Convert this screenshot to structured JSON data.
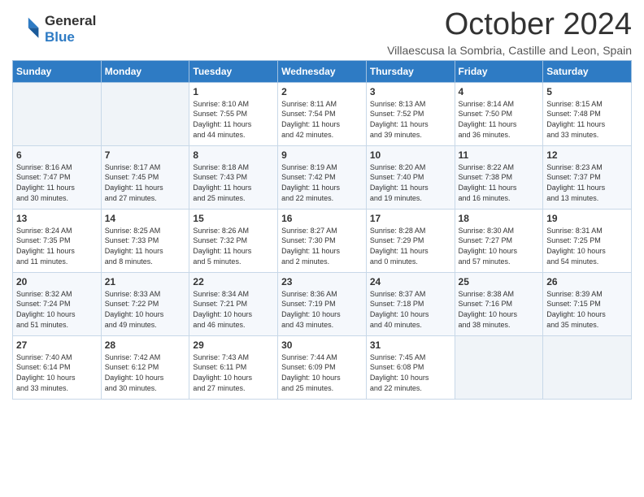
{
  "logo": {
    "line1": "General",
    "line2": "Blue"
  },
  "title": "October 2024",
  "subtitle": "Villaescusa la Sombria, Castille and Leon, Spain",
  "days_of_week": [
    "Sunday",
    "Monday",
    "Tuesday",
    "Wednesday",
    "Thursday",
    "Friday",
    "Saturday"
  ],
  "weeks": [
    [
      {
        "day": "",
        "lines": []
      },
      {
        "day": "",
        "lines": []
      },
      {
        "day": "1",
        "lines": [
          "Sunrise: 8:10 AM",
          "Sunset: 7:55 PM",
          "Daylight: 11 hours",
          "and 44 minutes."
        ]
      },
      {
        "day": "2",
        "lines": [
          "Sunrise: 8:11 AM",
          "Sunset: 7:54 PM",
          "Daylight: 11 hours",
          "and 42 minutes."
        ]
      },
      {
        "day": "3",
        "lines": [
          "Sunrise: 8:13 AM",
          "Sunset: 7:52 PM",
          "Daylight: 11 hours",
          "and 39 minutes."
        ]
      },
      {
        "day": "4",
        "lines": [
          "Sunrise: 8:14 AM",
          "Sunset: 7:50 PM",
          "Daylight: 11 hours",
          "and 36 minutes."
        ]
      },
      {
        "day": "5",
        "lines": [
          "Sunrise: 8:15 AM",
          "Sunset: 7:48 PM",
          "Daylight: 11 hours",
          "and 33 minutes."
        ]
      }
    ],
    [
      {
        "day": "6",
        "lines": [
          "Sunrise: 8:16 AM",
          "Sunset: 7:47 PM",
          "Daylight: 11 hours",
          "and 30 minutes."
        ]
      },
      {
        "day": "7",
        "lines": [
          "Sunrise: 8:17 AM",
          "Sunset: 7:45 PM",
          "Daylight: 11 hours",
          "and 27 minutes."
        ]
      },
      {
        "day": "8",
        "lines": [
          "Sunrise: 8:18 AM",
          "Sunset: 7:43 PM",
          "Daylight: 11 hours",
          "and 25 minutes."
        ]
      },
      {
        "day": "9",
        "lines": [
          "Sunrise: 8:19 AM",
          "Sunset: 7:42 PM",
          "Daylight: 11 hours",
          "and 22 minutes."
        ]
      },
      {
        "day": "10",
        "lines": [
          "Sunrise: 8:20 AM",
          "Sunset: 7:40 PM",
          "Daylight: 11 hours",
          "and 19 minutes."
        ]
      },
      {
        "day": "11",
        "lines": [
          "Sunrise: 8:22 AM",
          "Sunset: 7:38 PM",
          "Daylight: 11 hours",
          "and 16 minutes."
        ]
      },
      {
        "day": "12",
        "lines": [
          "Sunrise: 8:23 AM",
          "Sunset: 7:37 PM",
          "Daylight: 11 hours",
          "and 13 minutes."
        ]
      }
    ],
    [
      {
        "day": "13",
        "lines": [
          "Sunrise: 8:24 AM",
          "Sunset: 7:35 PM",
          "Daylight: 11 hours",
          "and 11 minutes."
        ]
      },
      {
        "day": "14",
        "lines": [
          "Sunrise: 8:25 AM",
          "Sunset: 7:33 PM",
          "Daylight: 11 hours",
          "and 8 minutes."
        ]
      },
      {
        "day": "15",
        "lines": [
          "Sunrise: 8:26 AM",
          "Sunset: 7:32 PM",
          "Daylight: 11 hours",
          "and 5 minutes."
        ]
      },
      {
        "day": "16",
        "lines": [
          "Sunrise: 8:27 AM",
          "Sunset: 7:30 PM",
          "Daylight: 11 hours",
          "and 2 minutes."
        ]
      },
      {
        "day": "17",
        "lines": [
          "Sunrise: 8:28 AM",
          "Sunset: 7:29 PM",
          "Daylight: 11 hours",
          "and 0 minutes."
        ]
      },
      {
        "day": "18",
        "lines": [
          "Sunrise: 8:30 AM",
          "Sunset: 7:27 PM",
          "Daylight: 10 hours",
          "and 57 minutes."
        ]
      },
      {
        "day": "19",
        "lines": [
          "Sunrise: 8:31 AM",
          "Sunset: 7:25 PM",
          "Daylight: 10 hours",
          "and 54 minutes."
        ]
      }
    ],
    [
      {
        "day": "20",
        "lines": [
          "Sunrise: 8:32 AM",
          "Sunset: 7:24 PM",
          "Daylight: 10 hours",
          "and 51 minutes."
        ]
      },
      {
        "day": "21",
        "lines": [
          "Sunrise: 8:33 AM",
          "Sunset: 7:22 PM",
          "Daylight: 10 hours",
          "and 49 minutes."
        ]
      },
      {
        "day": "22",
        "lines": [
          "Sunrise: 8:34 AM",
          "Sunset: 7:21 PM",
          "Daylight: 10 hours",
          "and 46 minutes."
        ]
      },
      {
        "day": "23",
        "lines": [
          "Sunrise: 8:36 AM",
          "Sunset: 7:19 PM",
          "Daylight: 10 hours",
          "and 43 minutes."
        ]
      },
      {
        "day": "24",
        "lines": [
          "Sunrise: 8:37 AM",
          "Sunset: 7:18 PM",
          "Daylight: 10 hours",
          "and 40 minutes."
        ]
      },
      {
        "day": "25",
        "lines": [
          "Sunrise: 8:38 AM",
          "Sunset: 7:16 PM",
          "Daylight: 10 hours",
          "and 38 minutes."
        ]
      },
      {
        "day": "26",
        "lines": [
          "Sunrise: 8:39 AM",
          "Sunset: 7:15 PM",
          "Daylight: 10 hours",
          "and 35 minutes."
        ]
      }
    ],
    [
      {
        "day": "27",
        "lines": [
          "Sunrise: 7:40 AM",
          "Sunset: 6:14 PM",
          "Daylight: 10 hours",
          "and 33 minutes."
        ]
      },
      {
        "day": "28",
        "lines": [
          "Sunrise: 7:42 AM",
          "Sunset: 6:12 PM",
          "Daylight: 10 hours",
          "and 30 minutes."
        ]
      },
      {
        "day": "29",
        "lines": [
          "Sunrise: 7:43 AM",
          "Sunset: 6:11 PM",
          "Daylight: 10 hours",
          "and 27 minutes."
        ]
      },
      {
        "day": "30",
        "lines": [
          "Sunrise: 7:44 AM",
          "Sunset: 6:09 PM",
          "Daylight: 10 hours",
          "and 25 minutes."
        ]
      },
      {
        "day": "31",
        "lines": [
          "Sunrise: 7:45 AM",
          "Sunset: 6:08 PM",
          "Daylight: 10 hours",
          "and 22 minutes."
        ]
      },
      {
        "day": "",
        "lines": []
      },
      {
        "day": "",
        "lines": []
      }
    ]
  ]
}
